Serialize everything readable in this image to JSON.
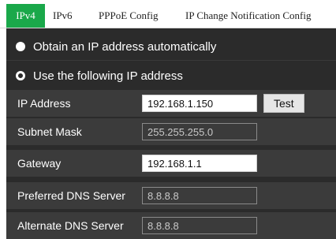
{
  "tabs": [
    {
      "label": "IPv4"
    },
    {
      "label": "IPv6"
    },
    {
      "label": "PPPoE Config"
    },
    {
      "label": "IP Change Notification Config"
    }
  ],
  "radios": {
    "auto_label": "Obtain an IP address automatically",
    "manual_label": "Use the following IP address"
  },
  "fields": {
    "ip_address": {
      "label": "IP Address",
      "value": "192.168.1.150"
    },
    "subnet_mask": {
      "label": "Subnet Mask",
      "value": "255.255.255.0"
    },
    "gateway": {
      "label": "Gateway",
      "value": "192.168.1.1"
    },
    "preferred_dns": {
      "label": "Preferred DNS Server",
      "value": "8.8.8.8"
    },
    "alternate_dns": {
      "label": "Alternate DNS Server",
      "value": "8.8.8.8"
    }
  },
  "test_button": "Test",
  "colors": {
    "accent": "#1aa84a",
    "panel": "#2b2b2b"
  }
}
